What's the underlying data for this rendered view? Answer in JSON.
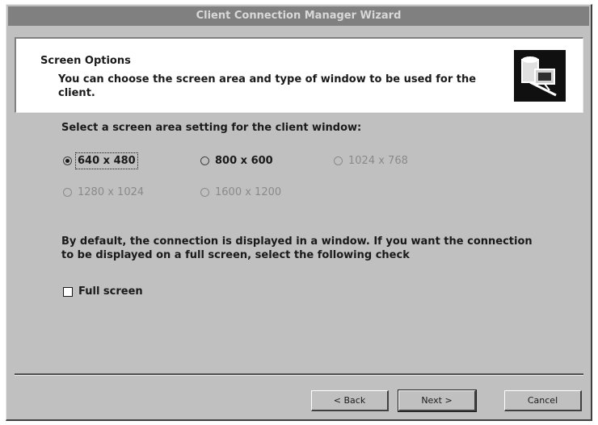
{
  "window": {
    "title": "Client Connection Manager Wizard"
  },
  "header": {
    "title": "Screen Options",
    "description": "You can choose the screen area and type of window to be used for the client.",
    "icon": "wizard-computer-icon"
  },
  "screen_area": {
    "prompt": "Select a screen area setting for the client window:",
    "options": [
      {
        "label": "640 x 480",
        "checked": true,
        "enabled": true
      },
      {
        "label": "800 x 600",
        "checked": false,
        "enabled": true
      },
      {
        "label": "1024 x 768",
        "checked": false,
        "enabled": false
      },
      {
        "label": "1280 x 1024",
        "checked": false,
        "enabled": false
      },
      {
        "label": "1600 x 1200",
        "checked": false,
        "enabled": false
      }
    ]
  },
  "fullscreen": {
    "info": "By default, the connection is displayed in a window. If you want the connection to be displayed on a full screen, select the following check",
    "label": "Full screen",
    "checked": false
  },
  "buttons": {
    "back": "< Back",
    "next": "Next >",
    "cancel": "Cancel"
  }
}
